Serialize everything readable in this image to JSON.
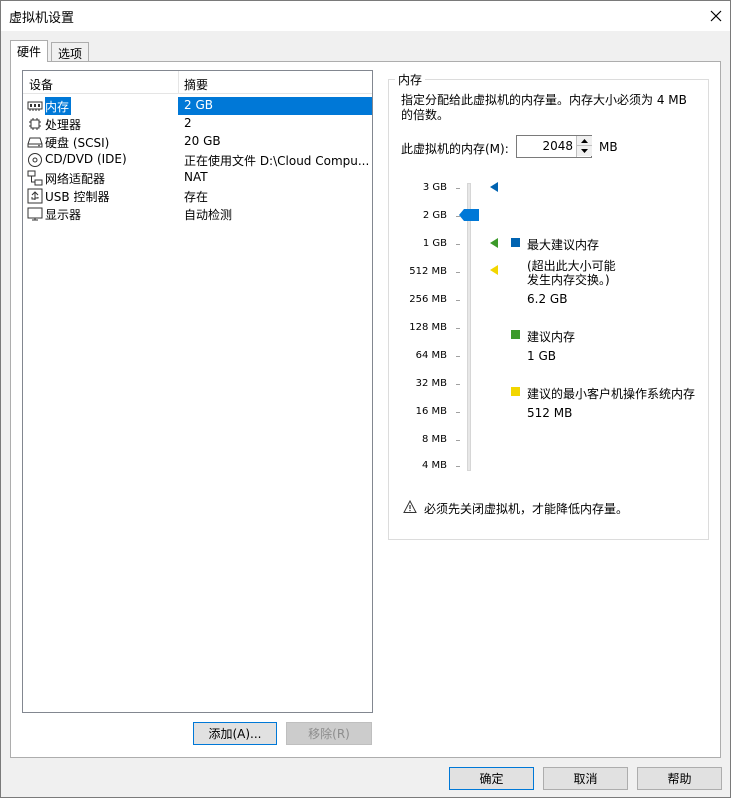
{
  "window": {
    "title": "虚拟机设置"
  },
  "tabs": [
    {
      "label": "硬件",
      "active": true
    },
    {
      "label": "选项",
      "active": false
    }
  ],
  "device_list": {
    "columns": [
      "设备",
      "摘要"
    ],
    "rows": [
      {
        "icon": "memory-icon",
        "name": "内存",
        "summary": "2 GB",
        "selected": true
      },
      {
        "icon": "processor-icon",
        "name": "处理器",
        "summary": "2",
        "selected": false
      },
      {
        "icon": "hard-disk-icon",
        "name": "硬盘 (SCSI)",
        "summary": "20 GB",
        "selected": false
      },
      {
        "icon": "cd-dvd-icon",
        "name": "CD/DVD (IDE)",
        "summary": "正在使用文件 D:\\Cloud Compu...",
        "selected": false
      },
      {
        "icon": "network-adapter-icon",
        "name": "网络适配器",
        "summary": "NAT",
        "selected": false
      },
      {
        "icon": "usb-controller-icon",
        "name": "USB 控制器",
        "summary": "存在",
        "selected": false
      },
      {
        "icon": "display-icon",
        "name": "显示器",
        "summary": "自动检测",
        "selected": false
      }
    ]
  },
  "list_buttons": {
    "add": "添加(A)...",
    "remove": "移除(R)"
  },
  "memory_panel": {
    "group_title": "内存",
    "info": "指定分配给此虚拟机的内存量。内存大小必须为 4 MB 的倍数。",
    "info_line1": "指定分配给此虚拟机的内存量。内存大小必须为 4 MB",
    "info_line2": "的倍数。",
    "memory_label": "此虚拟机的内存(M):",
    "memory_value": "2048",
    "unit": "MB",
    "scale_ticks": [
      "3 GB",
      "2 GB",
      "1 GB",
      "512 MB",
      "256 MB",
      "128 MB",
      "64 MB",
      "32 MB",
      "16 MB",
      "8 MB",
      "4 MB"
    ],
    "slider_value": "2 GB",
    "legend": {
      "max": {
        "label": "最大建议内存",
        "note_line1": "(超出此大小可能",
        "note_line2": "发生内存交换。)",
        "value": "6.2 GB",
        "color": "#0063b1"
      },
      "recommended": {
        "label": "建议内存",
        "value": "1 GB",
        "color": "#3c9a2a"
      },
      "guest_min": {
        "label": "建议的最小客户机操作系统内存",
        "value": "512 MB",
        "color": "#f2d600"
      }
    },
    "warning": "必须先关闭虚拟机，才能降低内存量。"
  },
  "footer_buttons": {
    "ok": "确定",
    "cancel": "取消",
    "help": "帮助"
  }
}
